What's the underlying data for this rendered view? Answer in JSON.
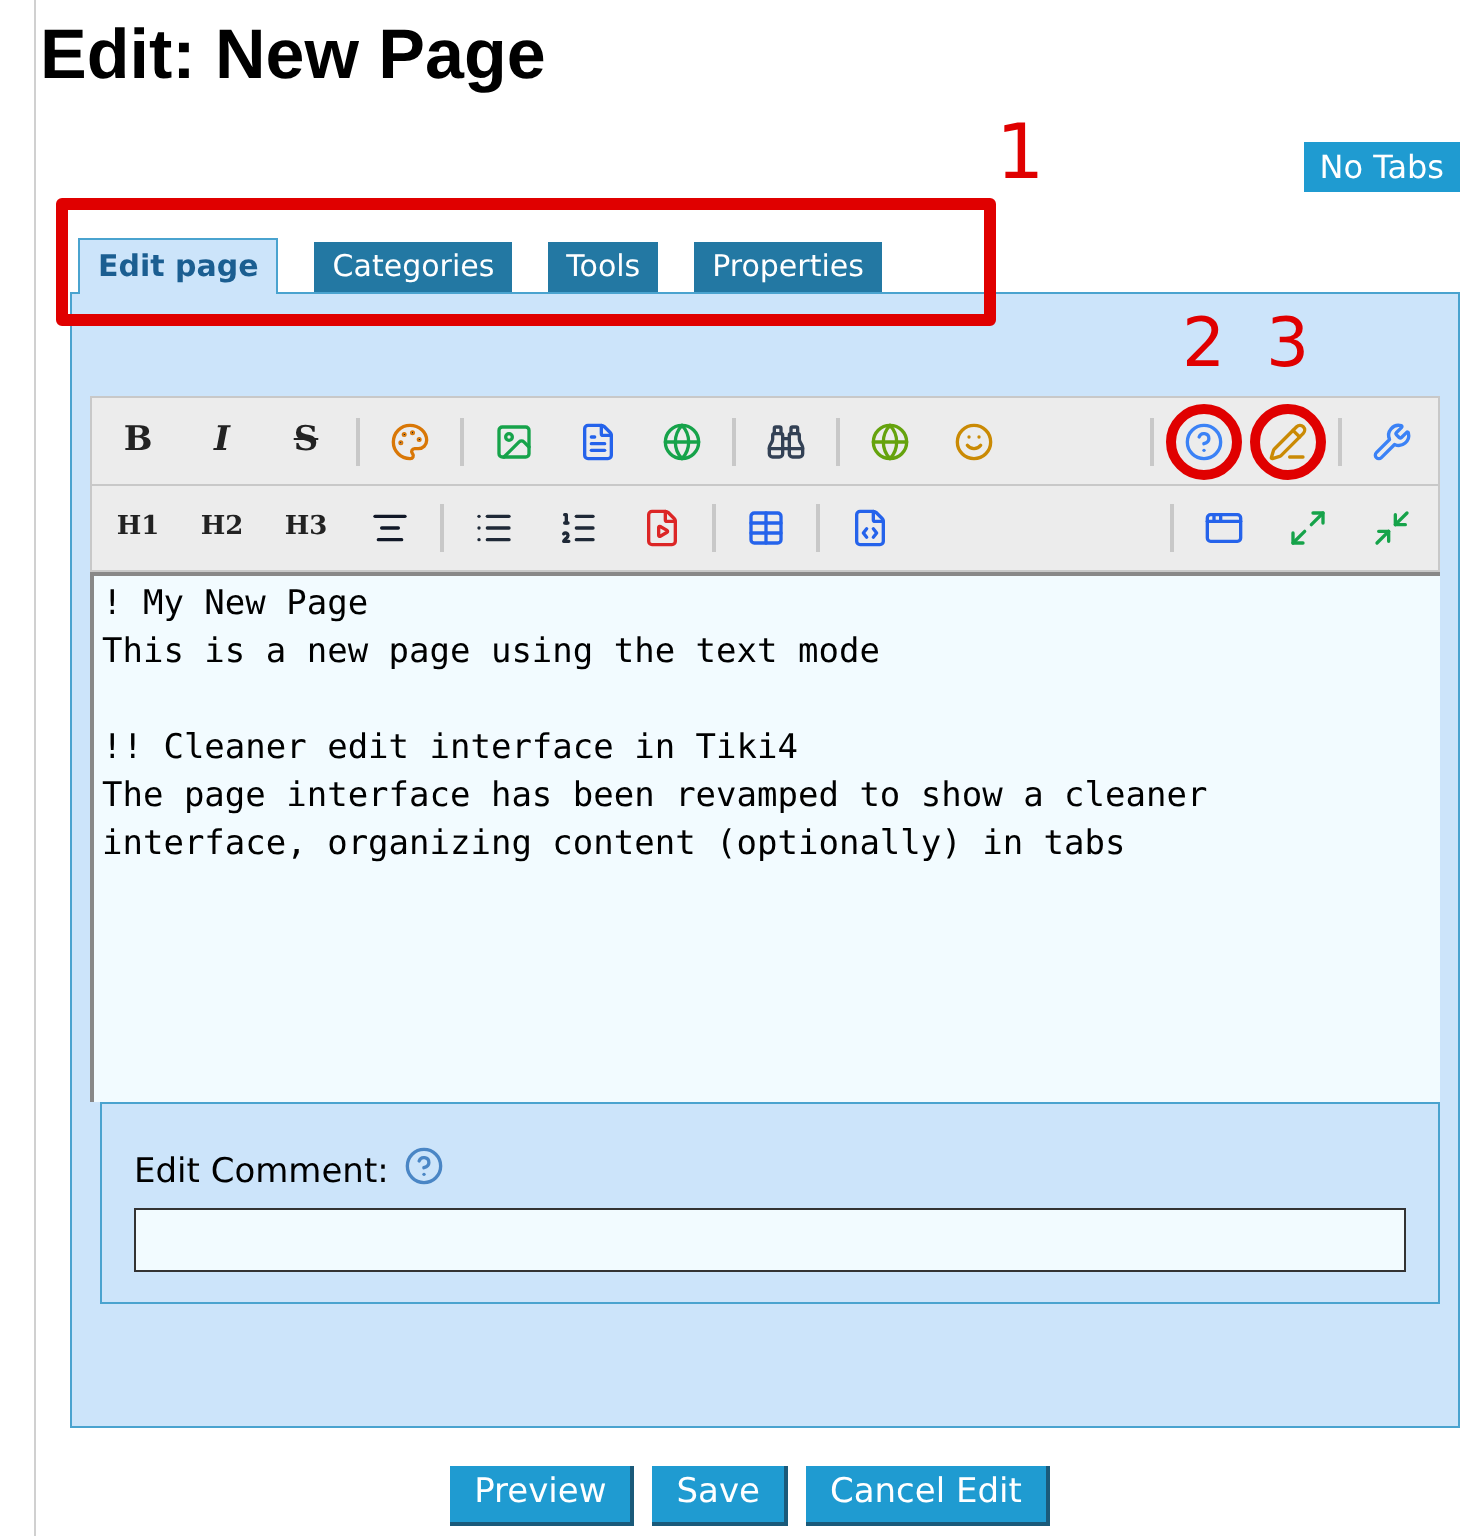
{
  "title": "Edit: New Page",
  "no_tabs_button": "No Tabs",
  "tabs": [
    {
      "label": "Edit page",
      "selected": true
    },
    {
      "label": "Categories",
      "selected": false
    },
    {
      "label": "Tools",
      "selected": false
    },
    {
      "label": "Properties",
      "selected": false
    }
  ],
  "tabs_callout": "1",
  "toolbar": {
    "rows": [
      [
        {
          "kind": "text",
          "label": "B"
        },
        {
          "kind": "text",
          "label": "I"
        },
        {
          "kind": "text",
          "label": "S"
        },
        {
          "kind": "sep"
        },
        {
          "kind": "icon"
        },
        {
          "kind": "sep"
        },
        {
          "kind": "icon"
        },
        {
          "kind": "icon"
        },
        {
          "kind": "icon"
        },
        {
          "kind": "sep"
        },
        {
          "kind": "icon"
        },
        {
          "kind": "sep"
        },
        {
          "kind": "icon"
        },
        {
          "kind": "icon"
        },
        {
          "kind": "spacer"
        },
        {
          "kind": "sep"
        },
        {
          "kind": "icon",
          "callout": "2"
        },
        {
          "kind": "icon",
          "callout": "3"
        },
        {
          "kind": "sep"
        },
        {
          "kind": "icon"
        }
      ],
      [
        {
          "kind": "text",
          "label": "H1"
        },
        {
          "kind": "text",
          "label": "H2"
        },
        {
          "kind": "text",
          "label": "H3"
        },
        {
          "kind": "icon"
        },
        {
          "kind": "sep"
        },
        {
          "kind": "icon"
        },
        {
          "kind": "icon"
        },
        {
          "kind": "icon"
        },
        {
          "kind": "sep"
        },
        {
          "kind": "icon"
        },
        {
          "kind": "sep"
        },
        {
          "kind": "icon"
        },
        {
          "kind": "spacer"
        },
        {
          "kind": "sep"
        },
        {
          "kind": "icon"
        },
        {
          "kind": "icon"
        },
        {
          "kind": "icon"
        }
      ]
    ]
  },
  "editor_text": "! My New Page\nThis is a new page using the text mode\n\n!! Cleaner edit interface in Tiki4\nThe page interface has been revamped to show a cleaner\ninterface, organizing content (optionally) in tabs",
  "edit_comment": {
    "label": "Edit Comment:"
  },
  "buttons": [
    "Preview",
    "Save",
    "Cancel Edit"
  ]
}
